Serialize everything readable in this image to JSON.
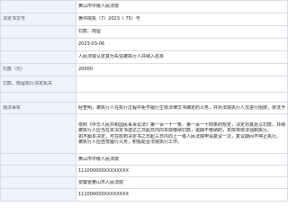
{
  "record": {
    "rows": [
      {
        "label": "",
        "value": "黄山市中级人民法院"
      },
      {
        "label": "决定书文号",
        "value": "黄中院执（7）2023（ 75）号"
      },
      {
        "label": "",
        "value": "罚款、拘留"
      },
      {
        "label": "",
        "value": "2023-03-06"
      },
      {
        "label": "",
        "value": "人民法院认定其为失信被执行人并纳入名单"
      },
      {
        "label": "罚款（元）",
        "value": "20000"
      },
      {
        "label": "罚款、拘留执行决定机关",
        "value": ""
      },
      {
        "label": "",
        "value": ""
      },
      {
        "label": "违法事实",
        "value": "经查明，被执行人在执行过程中拒不履行生效法律文书确定的义务，并对法院执行人员进行阻挠，依法予以罚款。"
      },
      {
        "label": "",
        "lines": [
          "依照《中华人民共和国民事诉讼法》第一百一十一条、第一百一十四条的规定，决定对其处以罚款，并纳入失信被执行人名单。",
          "被执行人应当在本决定书送达之日起日内向本院缴纳罚款，逾期不缴纳的，本院将依法强制执行。",
          "如不服本决定，可在收到决定书之日起三日内向上一级人民法院申请复议一次，复议期间不停止执行。",
          "被执行人应自觉履行义务，积极配合法院执行工作。"
        ]
      },
      {
        "label": "",
        "value": "黄山市中级人民法院"
      },
      {
        "label": "",
        "value": "111000000XXXXXXXX"
      },
      {
        "label": "",
        "value": "安徽省黄山市人民法院"
      },
      {
        "label": "",
        "value": "111000000XXXXXXXX"
      }
    ]
  }
}
